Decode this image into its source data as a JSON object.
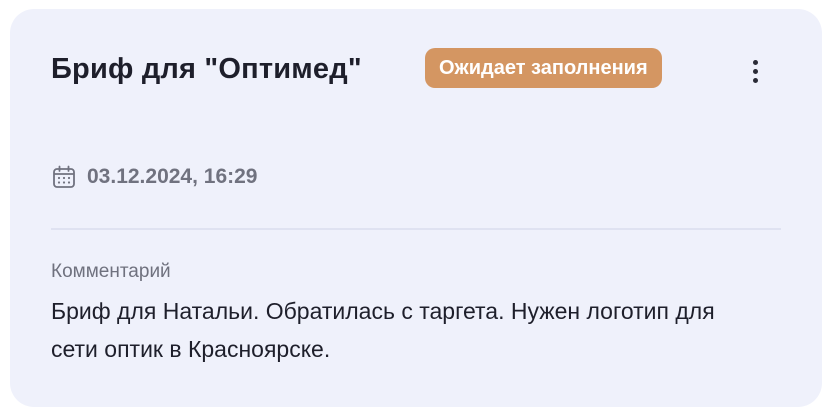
{
  "card": {
    "title": "Бриф для \"Оптимед\"",
    "status_badge": "Ожидает заполнения",
    "date": "03.12.2024, 16:29",
    "comment_label": "Комментарий",
    "comment_text": "Бриф для Натальи. Обратилась с таргета. Нужен логотип для сети оптик в Красноярске.",
    "icons": {
      "date": "calendar-icon",
      "menu": "more-vertical-icon"
    }
  },
  "colors": {
    "card_background": "#eff1fb",
    "badge_background": "#d49662",
    "badge_text": "#ffffff",
    "title_text": "#1e1f2b",
    "secondary_text": "#70727f",
    "divider": "#dfe2f1"
  }
}
